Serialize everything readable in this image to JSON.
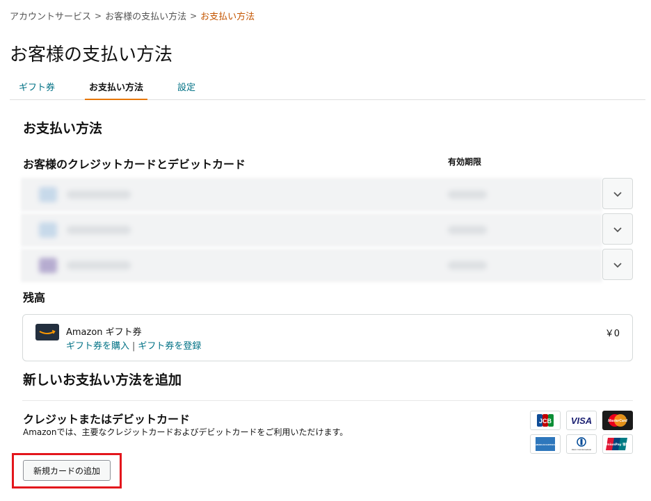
{
  "breadcrumb": {
    "items": [
      "アカウントサービス",
      "お客様の支払い方法"
    ],
    "current": "お支払い方法",
    "separator": ">"
  },
  "page_title": "お客様の支払い方法",
  "tabs": [
    {
      "label": "ギフト券",
      "active": false
    },
    {
      "label": "お支払い方法",
      "active": true
    },
    {
      "label": "設定",
      "active": false
    }
  ],
  "payment_section": {
    "title": "お支払い方法",
    "cards_title": "お客様のクレジットカードとデビットカード",
    "expiry_header": "有効期限",
    "cards": [
      {
        "blurred": true,
        "expand_icon": "chevron-down-icon"
      },
      {
        "blurred": true,
        "expand_icon": "chevron-down-icon"
      },
      {
        "blurred": true,
        "expand_icon": "chevron-down-icon"
      }
    ]
  },
  "balance": {
    "title": "残高",
    "name": "Amazon ギフト券",
    "buy_link": "ギフト券を購入",
    "separator": "|",
    "register_link": "ギフト券を登録",
    "amount": "￥0"
  },
  "add_method": {
    "title": "新しいお支払い方法を追加",
    "card_title": "クレジットまたはデビットカード",
    "card_description": "Amazonでは、主要なクレジットカードおよびデビットカードをご利用いただけます。",
    "add_button": "新規カードの追加",
    "card_logos": [
      "JCB",
      "VISA",
      "MasterCard",
      "AMERICAN EXPRESS",
      "Diners Club International",
      "UnionPay 银联"
    ]
  },
  "colors": {
    "link": "#007185",
    "breadcrumb_current": "#c45500",
    "tab_active_underline": "#e77600",
    "highlight_border": "#e3161c"
  }
}
